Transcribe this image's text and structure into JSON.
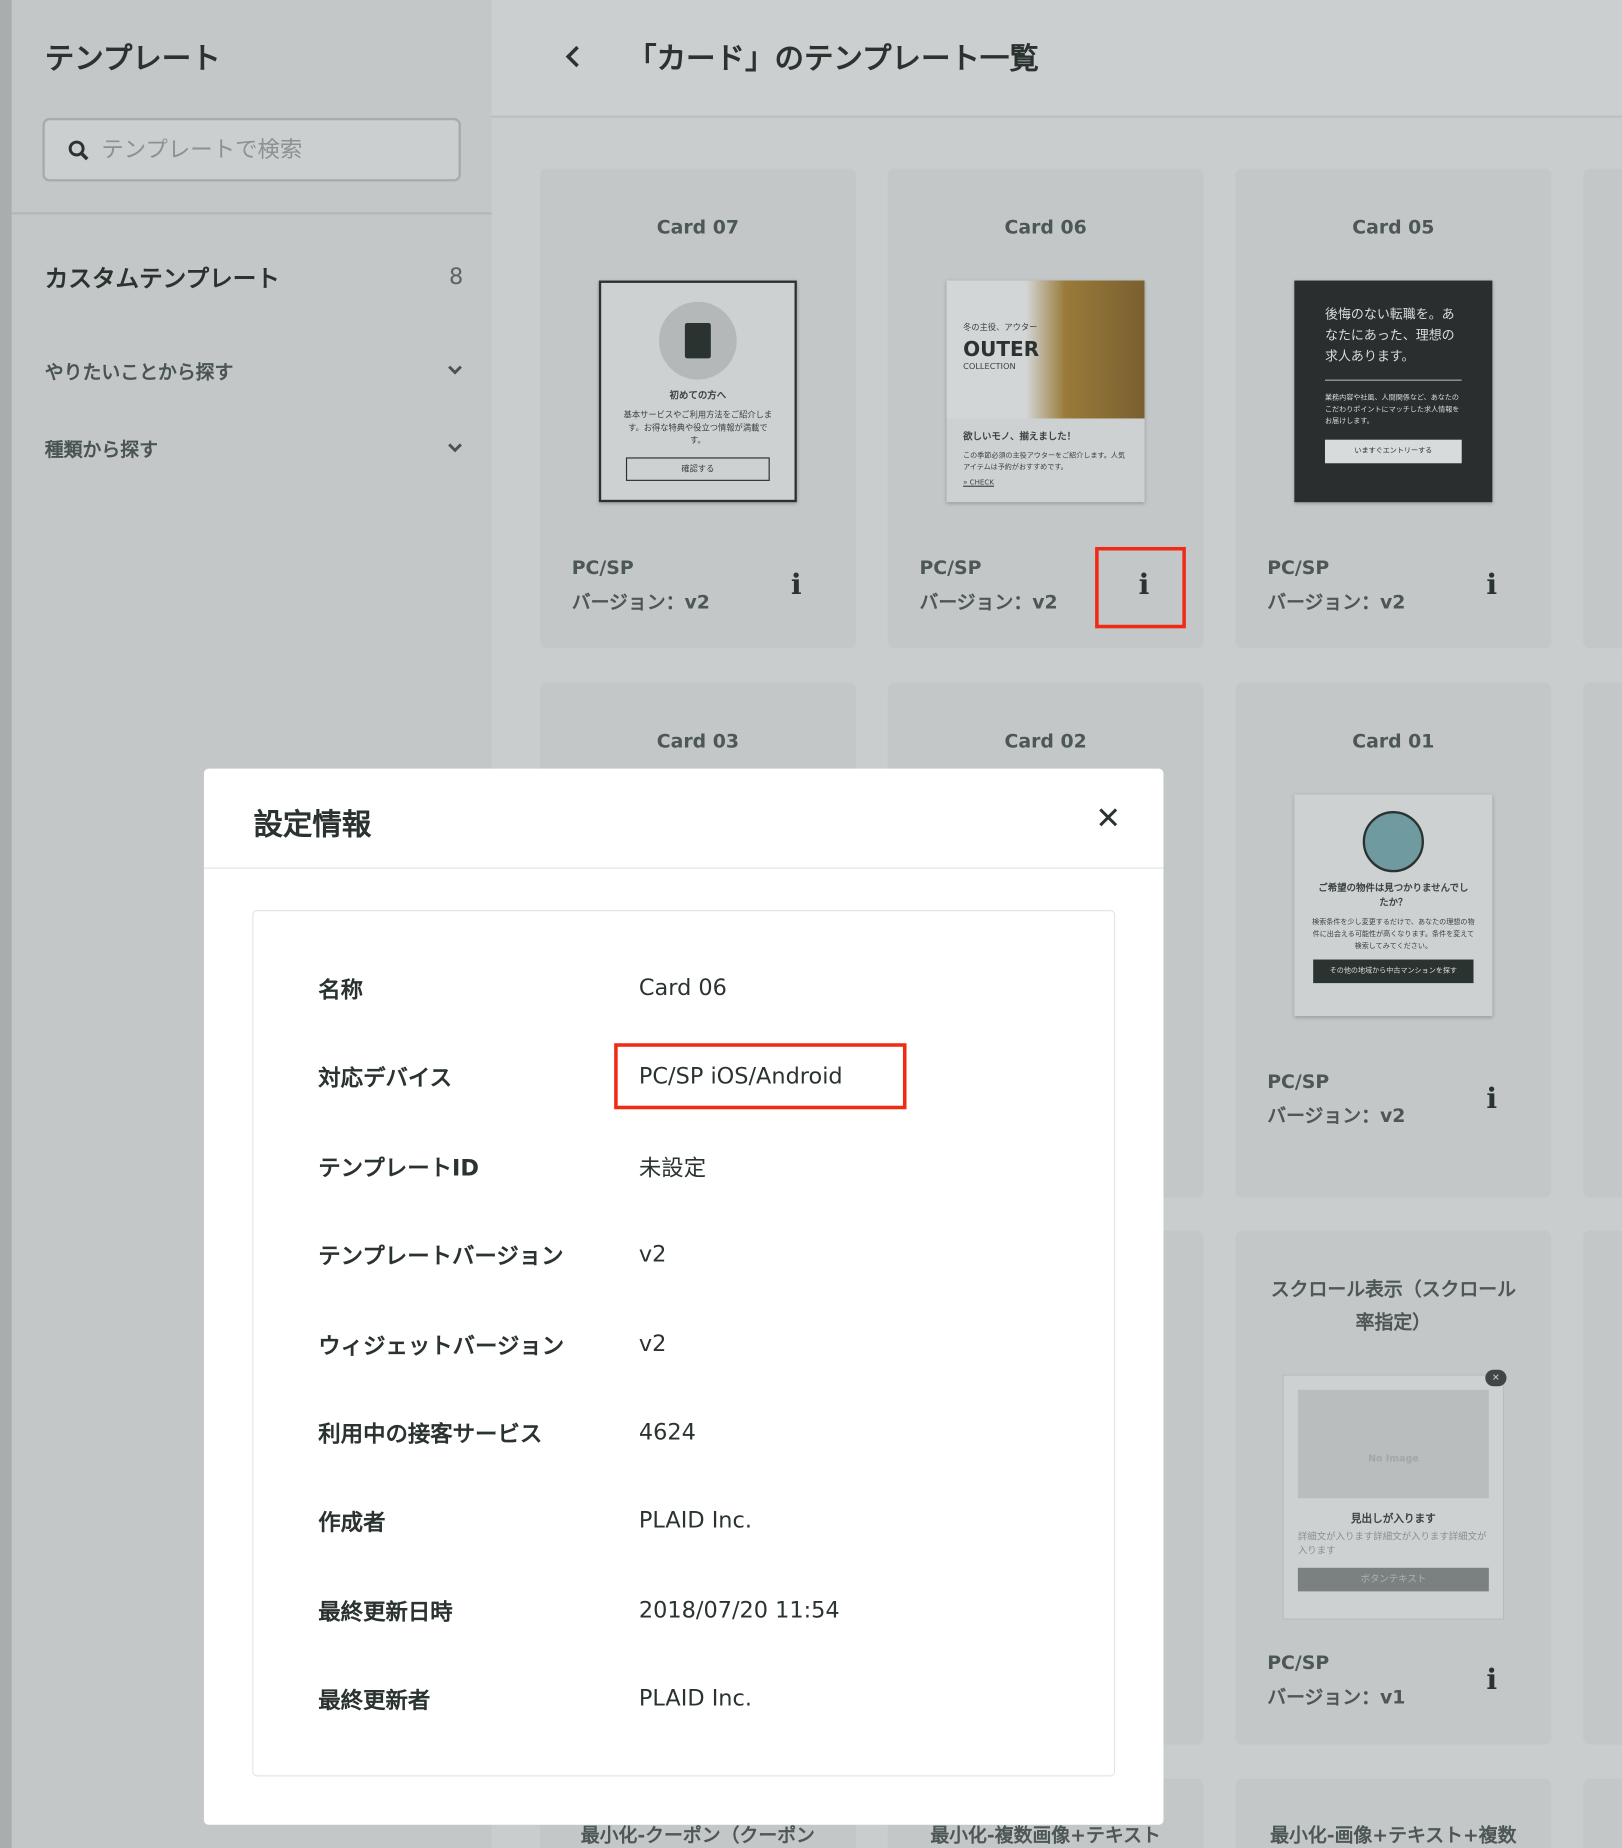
{
  "sidebar": {
    "title": "テンプレート",
    "search_placeholder": "テンプレートで検索",
    "custom_label": "カスタムテンプレート",
    "custom_count": "8",
    "accordions": [
      {
        "label": "やりたいことから探す"
      },
      {
        "label": "種類から探す"
      }
    ]
  },
  "header": {
    "title": "「カード」のテンプレート一覧"
  },
  "cards": [
    {
      "title": "Card 07",
      "device": "PC/SP",
      "version": "バージョン：v2"
    },
    {
      "title": "Card 06",
      "device": "PC/SP",
      "version": "バージョン：v2"
    },
    {
      "title": "Card 05",
      "device": "PC/SP",
      "version": "バージョン：v2"
    },
    {
      "title": "Card 03"
    },
    {
      "title": "Card 02"
    },
    {
      "title": "Card 01",
      "device": "PC/SP",
      "version": "バージョン：v2"
    },
    {
      "title": "スクロール表示（スクロール率指定）",
      "device": "PC/SP",
      "version": "バージョン：v1"
    },
    {
      "title": "最小化-クーポン（クーポン"
    },
    {
      "title": "最小化-複数画像+テキスト"
    },
    {
      "title": "最小化-画像+テキスト+複数"
    }
  ],
  "thumbs": {
    "card07": {
      "heading": "初めての方へ",
      "body": "基本サービスやご利用方法をご紹介します。お得な特典や役立つ情報が満載です。",
      "button": "確認する"
    },
    "card06": {
      "kicker": "冬の主役、アウター",
      "brand": "OUTER",
      "sub": "COLLECTION",
      "heading": "欲しいモノ、揃えました！",
      "body": "この季節必須の主役アウターをご紹介します。人気アイテムは予約がおすすめです。",
      "link": "» CHECK"
    },
    "card05": {
      "heading": "後悔のない転職を。あなたにあった、理想の求人あります。",
      "body": "業務内容や社風、人間関係など、あなたのこだわりポイントにマッチした求人情報をお届けします。",
      "button": "いますぐエントリーする"
    },
    "card01": {
      "heading": "ご希望の物件は見つかりませんでしたか？",
      "body": "検索条件を少し変更するだけで、あなたの理想の物件に出会える可能性が高くなります。条件を変えて検索してみてください。",
      "button": "その他の地域から中古マンションを探す"
    },
    "scroll": {
      "noimage": "No Image",
      "heading": "見出しが入ります",
      "body": "詳細文が入ります詳細文が入ります詳細文が入ります",
      "button": "ボタンテキスト"
    }
  },
  "modal": {
    "title": "設定情報",
    "rows": [
      {
        "label": "名称",
        "value": "Card 06"
      },
      {
        "label": "対応デバイス",
        "value": "PC/SP iOS/Android"
      },
      {
        "label": "テンプレートID",
        "value": "未設定"
      },
      {
        "label": "テンプレートバージョン",
        "value": "v2"
      },
      {
        "label": "ウィジェットバージョン",
        "value": "v2"
      },
      {
        "label": "利用中の接客サービス",
        "value": "4624"
      },
      {
        "label": "作成者",
        "value": "PLAID Inc."
      },
      {
        "label": "最終更新日時",
        "value": "2018/07/20 11:54"
      },
      {
        "label": "最終更新者",
        "value": "PLAID Inc."
      }
    ]
  },
  "icons": {
    "info": "i",
    "close": "✕",
    "back": "‹",
    "chevron": "⌄"
  },
  "colors": {
    "highlight": "#ef2b16"
  }
}
